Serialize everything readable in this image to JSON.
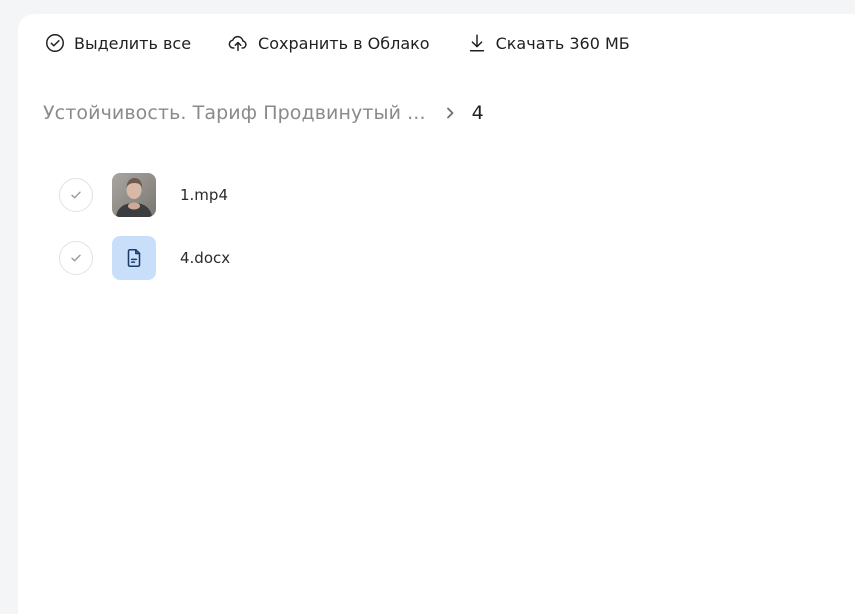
{
  "toolbar": {
    "select_all_label": "Выделить все",
    "save_cloud_label": "Сохранить в Облако",
    "download_label": "Скачать 360 МБ"
  },
  "breadcrumb": {
    "parent": "Устойчивость. Тариф Продвинутый ...",
    "current": "4"
  },
  "files": [
    {
      "name": "1.mp4",
      "type": "video",
      "icon": "video-thumbnail"
    },
    {
      "name": "4.docx",
      "type": "document",
      "icon": "document-icon"
    }
  ],
  "colors": {
    "background": "#f4f5f7",
    "panel": "#ffffff",
    "doc_thumb": "#c9def9",
    "doc_icon": "#1c3a6b",
    "muted_text": "#8a8a8a"
  }
}
